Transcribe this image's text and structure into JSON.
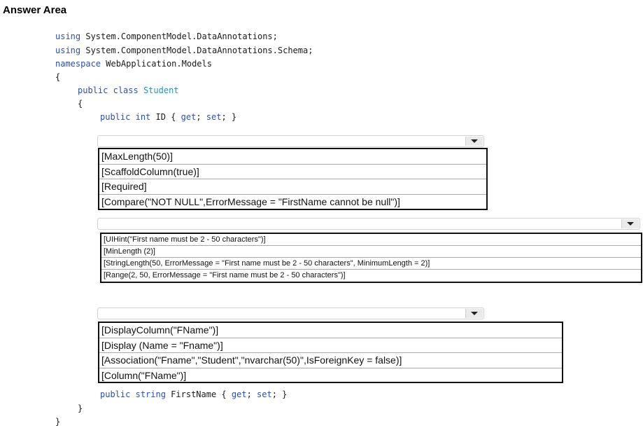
{
  "title": "Answer Area",
  "code": {
    "using1_kw": "using",
    "using1_rest": " System.ComponentModel.DataAnnotations;",
    "using2_kw": "using",
    "using2_rest": " System.ComponentModel.DataAnnotations.Schema;",
    "ns_kw": "namespace",
    "ns_rest": " WebApplication.Models",
    "brace_open": "{",
    "class_kw1": "public",
    "class_kw2": "class",
    "class_name": "Student",
    "class_brace_open": "{",
    "id_kw1": "public",
    "id_kw2": "int",
    "id_name": " ID { ",
    "id_get": "get",
    "id_mid": "; ",
    "id_set": "set",
    "id_end": "; }",
    "fn_kw1": "public",
    "fn_kw2": "string",
    "fn_name": " FirstName { ",
    "fn_get": "get",
    "fn_mid": "; ",
    "fn_set": "set",
    "fn_end": "; }",
    "class_brace_close": "}",
    "brace_close": "}"
  },
  "dropdown1": {
    "options": [
      "[MaxLength(50)]",
      "[ScaffoldColumn(true)]",
      "[Required]",
      "[Compare(\"NOT NULL\",ErrorMessage = \"FirstName cannot be null\")]"
    ]
  },
  "dropdown2": {
    "options": [
      "[UIHint(\"First name must be 2 - 50 characters\")]",
      "[MinLength (2)]",
      "[StringLength(50, ErrorMessage = \"First name must be 2 - 50 characters\", MinimumLength = 2)]",
      "[Range(2, 50, ErrorMessage = \"First name must be 2 - 50 characters\")]"
    ]
  },
  "dropdown3": {
    "options": [
      "[DisplayColumn(\"FName\")]",
      "[Display (Name = \"Fname\")]",
      "[Association(\"Fname\",\"Student\",\"nvarchar(50)\",IsForeignKey = false)]",
      "[Column(\"FName\")]"
    ]
  }
}
